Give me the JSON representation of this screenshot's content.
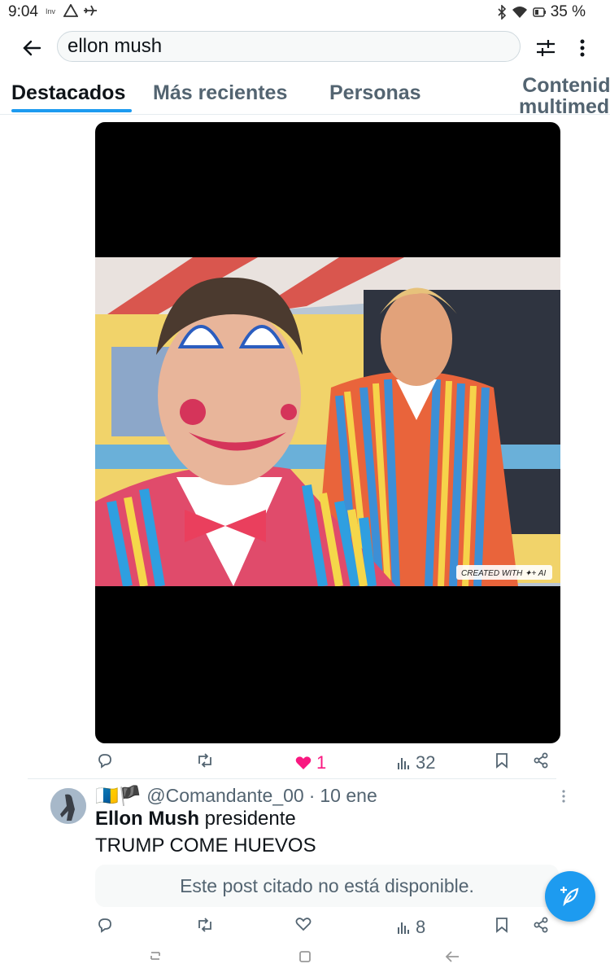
{
  "status_bar": {
    "time": "9:04",
    "left_icons": [
      "sim-icon",
      "warning-icon",
      "airplane-icon"
    ],
    "right_icons": [
      "bluetooth-icon",
      "wifi-icon",
      "battery-icon"
    ],
    "battery": "35 %"
  },
  "search": {
    "query": "ellon mush"
  },
  "tabs": [
    {
      "label": "Destacados",
      "active": true
    },
    {
      "label": "Más recientes",
      "active": false
    },
    {
      "label": "Personas",
      "active": false
    },
    {
      "label": "Contenido multimedia",
      "active": false
    }
  ],
  "post1": {
    "image_badge": "CREATED WITH ✦+ AI",
    "actions": {
      "replies": "",
      "reposts": "",
      "likes": "1",
      "views": "32"
    }
  },
  "post2": {
    "flags": "🇮🇨🏴",
    "handle": "@Comandante_00",
    "separator": "·",
    "time": "10 ene",
    "text_bold": "Ellon Mush",
    "text_rest": " presidente",
    "text_line2": "TRUMP COME HUEVOS",
    "quoted_unavailable": "Este post citado no está disponible.",
    "actions": {
      "replies": "",
      "reposts": "",
      "likes": "",
      "views": "8"
    }
  },
  "colors": {
    "accent": "#1d9bf0",
    "like": "#f91880",
    "muted": "#536471"
  }
}
